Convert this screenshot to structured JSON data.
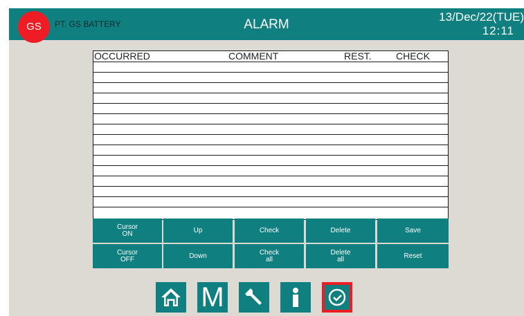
{
  "header": {
    "logo": "GS",
    "company": "PT. GS BATTERY",
    "title": "ALARM",
    "date": "13/Dec/22(TUE)",
    "time": "12:11"
  },
  "table": {
    "columns": [
      "OCCURRED",
      "COMMENT",
      "REST.",
      "CHECK"
    ],
    "rows": [
      [],
      [],
      [],
      [],
      [],
      [],
      [],
      [],
      [],
      [],
      [],
      [],
      [],
      [],
      [],
      []
    ]
  },
  "buttons": {
    "cursor_on": "Cursor\nON",
    "up": "Up",
    "check": "Check",
    "delete": "Delete",
    "save": "Save",
    "cursor_off": "Cursor\nOFF",
    "down": "Down",
    "check_all": "Check\nall",
    "delete_all": "Delete\nall",
    "reset": "Reset"
  },
  "nav": {
    "home_icon": "home-icon",
    "manual_label": "M",
    "wrench_icon": "wrench-icon",
    "info_icon": "info-icon",
    "clock_icon": "clock-icon",
    "active_color": "#ee1c25"
  },
  "colors": {
    "teal": "#0f7f80",
    "red": "#ee1c25",
    "background": "#dcdad3"
  }
}
